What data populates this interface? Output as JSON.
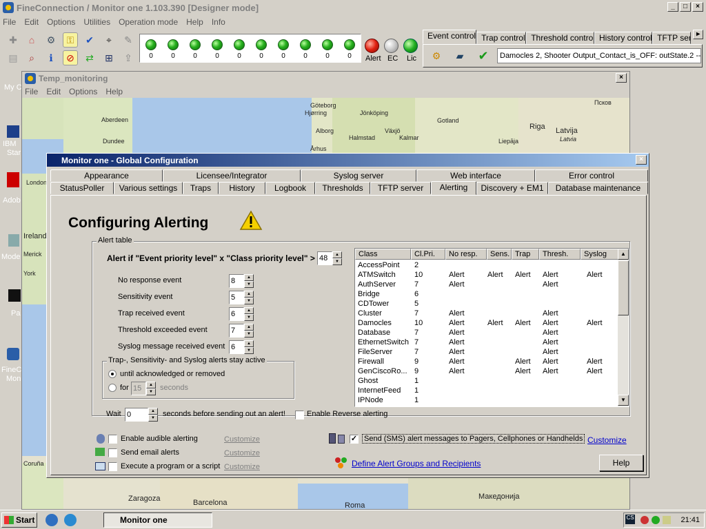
{
  "main_window": {
    "title": "FineConnection / Monitor one 1.103.390 [Designer mode]",
    "menu": [
      "File",
      "Edit",
      "Options",
      "Utilities",
      "Operation mode",
      "Help",
      "Info"
    ],
    "led_counts": [
      "0",
      "0",
      "0",
      "0",
      "0",
      "0",
      "0",
      "0",
      "0",
      "0"
    ],
    "status_lamps": [
      {
        "label": "Alert",
        "color": "#e02010"
      },
      {
        "label": "EC",
        "color": "#c8c8c8"
      },
      {
        "label": "Lic",
        "color": "#22b022"
      }
    ],
    "event_tabs": [
      "Event control",
      "Trap control",
      "Threshold control",
      "History control",
      "TFTP serv"
    ],
    "event_message": "Damocles 2, Shooter Output_Contact_is_OFF: outState.2 -->"
  },
  "temp_window": {
    "title": "Temp_monitoring",
    "menu": [
      "File",
      "Edit",
      "Options",
      "Help"
    ]
  },
  "map_labels": [
    "Göteborg",
    "Jönköping",
    "Hjørring",
    "Aberdeen",
    "Alborg",
    "Gotland",
    "Växjö",
    "Halmstad",
    "Kalmar",
    "Dundee",
    "Århus",
    "Riga",
    "Latvija",
    "Liepāja",
    "Псков",
    "Latvia",
    "London",
    "Ireland",
    "Coruña",
    "Zaragoza",
    "Barcelona",
    "Roma",
    "Македонија",
    "Merick",
    "York"
  ],
  "desktop": {
    "labels": [
      "My C",
      "IBM",
      "Star",
      "Adob",
      "Mode",
      "Pa",
      "FineC",
      "Mon"
    ]
  },
  "dialog": {
    "title": "Monitor one - Global Configuration",
    "tabs_row1": [
      "Appearance",
      "Licensee/Integrator",
      "Syslog server",
      "Web interface",
      "Error control"
    ],
    "tabs_row2": [
      "StatusPoller",
      "Various settings",
      "Traps",
      "History",
      "Logbook",
      "Thresholds",
      "TFTP server",
      "Alerting",
      "Discovery + EM1",
      "Database maintenance"
    ],
    "active_tab": "Alerting",
    "heading": "Configuring Alerting",
    "alert_table_group": "Alert table",
    "alert_if_label": "Alert if \"Event priority level\" x \"Class priority level\" >",
    "alert_threshold": "48",
    "events": [
      {
        "label": "No response event",
        "value": "8"
      },
      {
        "label": "Sensitivity event",
        "value": "5"
      },
      {
        "label": "Trap received event",
        "value": "6"
      },
      {
        "label": "Threshold exceeded event",
        "value": "7"
      },
      {
        "label": "Syslog message received event",
        "value": "6"
      }
    ],
    "stay_active_group": "Trap-, Sensitivity- and Syslog alerts stay active",
    "radio_until": "until acknowledged or removed",
    "radio_for": "for",
    "for_value": "15",
    "seconds_label": "seconds",
    "wait_label": "Wait",
    "wait_value": "0",
    "wait_suffix": "seconds before sending out an alert!",
    "enable_reverse": "Enable Reverse alerting",
    "table_headers": [
      "Class",
      "Cl.Pri.",
      "No resp.",
      "Sens.",
      "Trap",
      "Thresh.",
      "Syslog"
    ],
    "table_rows": [
      [
        "AccessPoint",
        "2",
        "",
        "",
        "",
        "",
        ""
      ],
      [
        "ATMSwitch",
        "10",
        "Alert",
        "Alert",
        "Alert",
        "Alert",
        "Alert"
      ],
      [
        "AuthServer",
        "7",
        "Alert",
        "",
        "",
        "Alert",
        ""
      ],
      [
        "Bridge",
        "6",
        "",
        "",
        "",
        "",
        ""
      ],
      [
        "CDTower",
        "5",
        "",
        "",
        "",
        "",
        ""
      ],
      [
        "Cluster",
        "7",
        "Alert",
        "",
        "",
        "Alert",
        ""
      ],
      [
        "Damocles",
        "10",
        "Alert",
        "Alert",
        "Alert",
        "Alert",
        "Alert"
      ],
      [
        "Database",
        "7",
        "Alert",
        "",
        "",
        "Alert",
        ""
      ],
      [
        "EthernetSwitch",
        "7",
        "Alert",
        "",
        "",
        "Alert",
        ""
      ],
      [
        "FileServer",
        "7",
        "Alert",
        "",
        "",
        "Alert",
        ""
      ],
      [
        "Firewall",
        "9",
        "Alert",
        "",
        "Alert",
        "Alert",
        "Alert"
      ],
      [
        "GenCiscoRo...",
        "9",
        "Alert",
        "",
        "Alert",
        "Alert",
        "Alert"
      ],
      [
        "Ghost",
        "1",
        "",
        "",
        "",
        "",
        ""
      ],
      [
        "InternetFeed",
        "1",
        "",
        "",
        "",
        "",
        ""
      ],
      [
        "IPNode",
        "1",
        "",
        "",
        "",
        "",
        ""
      ]
    ],
    "enable_audible": "Enable audible alerting",
    "send_email": "Send email alerts",
    "execute_program": "Execute a program or a script",
    "customize": "Customize",
    "send_sms": "Send (SMS) alert messages to Pagers, Cellphones or Handhelds",
    "define_groups": "Define Alert Groups and Recipients",
    "help_button": "Help"
  },
  "taskbar": {
    "start": "Start",
    "task": "Monitor one",
    "clock": "21:41"
  }
}
